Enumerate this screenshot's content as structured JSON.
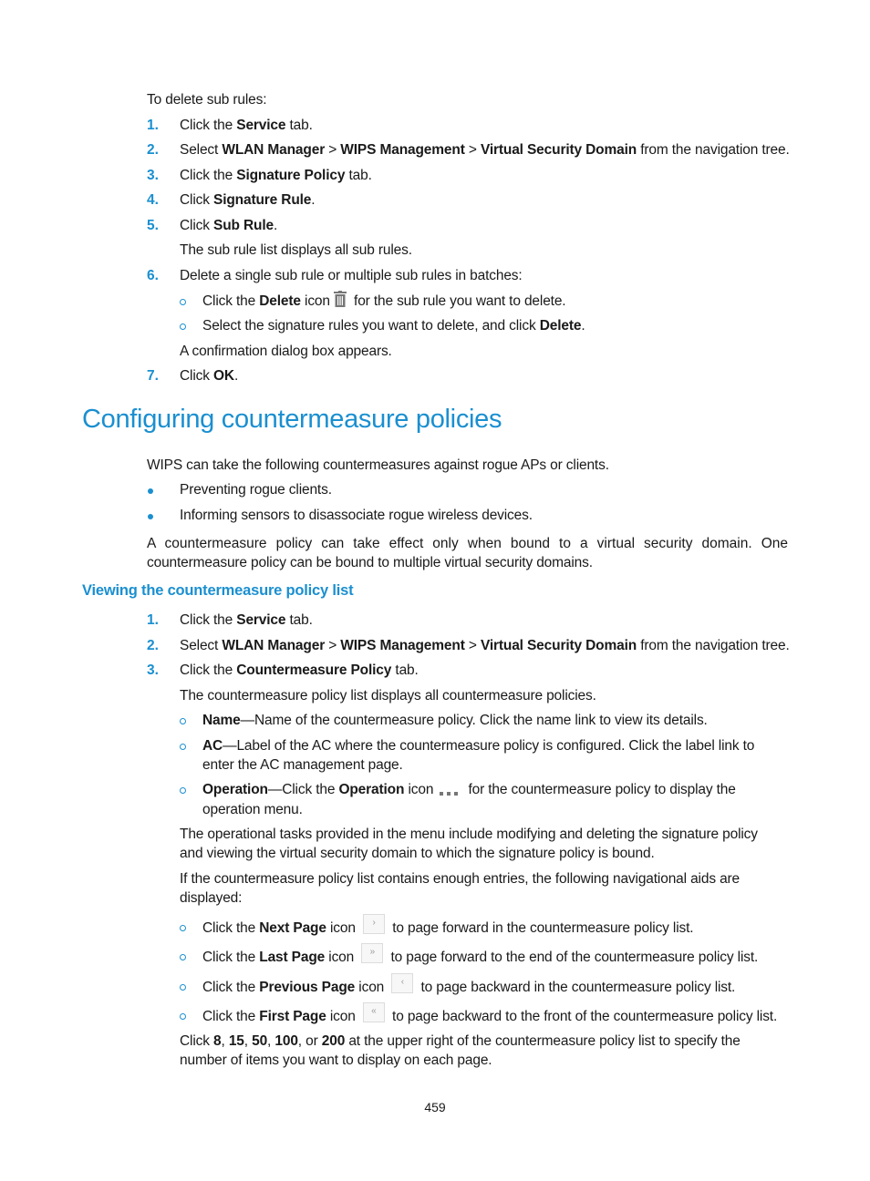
{
  "section_delete": {
    "intro": "To delete sub rules:",
    "steps": [
      {
        "num": "1.",
        "pre": "Click the ",
        "b1": "Service",
        "post": " tab."
      },
      {
        "num": "2.",
        "pre": "Select ",
        "b1": "WLAN Manager",
        "sep1": " > ",
        "b2": "WIPS Management",
        "sep2": " > ",
        "b3": "Virtual Security Domain",
        "post": " from the navigation tree."
      },
      {
        "num": "3.",
        "pre": "Click the ",
        "b1": "Signature Policy",
        "post": " tab."
      },
      {
        "num": "4.",
        "pre": "Click ",
        "b1": "Signature Rule",
        "post": "."
      },
      {
        "num": "5.",
        "pre": "Click ",
        "b1": "Sub Rule",
        "post": "."
      },
      {
        "num": "6.",
        "text": "Delete a single sub rule or multiple sub rules in batches:"
      },
      {
        "num": "7.",
        "pre": "Click ",
        "b1": "OK",
        "post": "."
      }
    ],
    "step5_note": "The sub rule list displays all sub rules.",
    "sub_bullets": [
      {
        "pre": "Click the ",
        "b1": "Delete",
        "mid": " icon",
        "icon": "trash-icon",
        "post": " for the sub rule you want to delete."
      },
      {
        "pre": "Select the signature rules you want to delete, and click ",
        "b1": "Delete",
        "post": "."
      }
    ],
    "step6_note": "A confirmation dialog box appears."
  },
  "heading_main": "Configuring countermeasure policies",
  "intro_para": "WIPS can take the following countermeasures against rogue APs or clients.",
  "bullets": [
    "Preventing rogue clients.",
    "Informing sensors to disassociate rogue wireless devices."
  ],
  "binding_para": {
    "line1": "A countermeasure policy can take effect only when bound to a virtual security domain. One",
    "line2": "countermeasure policy can be bound to multiple virtual security domains."
  },
  "heading_sub": "Viewing the countermeasure policy list",
  "section_view": {
    "steps": [
      {
        "num": "1.",
        "pre": "Click the ",
        "b1": "Service",
        "post": " tab."
      },
      {
        "num": "2.",
        "pre": "Select ",
        "b1": "WLAN Manager",
        "sep1": " > ",
        "b2": "WIPS Management",
        "sep2": " > ",
        "b3": "Virtual Security Domain",
        "post": " from the navigation tree."
      },
      {
        "num": "3.",
        "pre": "Click the ",
        "b1": "Countermeasure Policy",
        "post": " tab."
      }
    ],
    "list_note": "The countermeasure policy list displays all countermeasure policies.",
    "fields": [
      {
        "b1": "Name",
        "line1": "—Name of the countermeasure policy. Click the name link to view its details."
      },
      {
        "b1": "AC",
        "line1": "—Label of the AC where the countermeasure policy is configured. Click the label link to",
        "line2": "enter the AC management page."
      },
      {
        "b1": "Operation",
        "pre": "—Click the ",
        "b2": "Operation",
        "mid": " icon",
        "icon": "more-dots-icon",
        "post": " for the countermeasure policy to display the",
        "line2": "operation menu."
      }
    ],
    "ops_para": {
      "line1": "The operational tasks provided in the menu include modifying and deleting the signature policy",
      "line2": "and viewing the virtual security domain to which the signature policy is bound."
    },
    "nav_para": {
      "line1": "If the countermeasure policy list contains enough entries, the following navigational aids are",
      "line2": "displayed:"
    },
    "nav_items": [
      {
        "pre": "Click the ",
        "b1": "Next Page",
        "mid": " icon",
        "glyph": "›",
        "icon": "next-page-icon",
        "post": "to page forward in the countermeasure policy list."
      },
      {
        "pre": "Click the ",
        "b1": "Last Page",
        "mid": " icon",
        "glyph": "»",
        "icon": "last-page-icon",
        "post": "to page forward to the end of the countermeasure policy list."
      },
      {
        "pre": "Click the ",
        "b1": "Previous Page",
        "mid": " icon",
        "glyph": "‹",
        "icon": "previous-page-icon",
        "post": "to page backward in the countermeasure policy list."
      },
      {
        "pre": "Click the ",
        "b1": "First Page",
        "mid": " icon",
        "glyph": "«",
        "icon": "first-page-icon",
        "post": "to page backward to the front of the countermeasure policy list."
      }
    ],
    "page_size_para": {
      "pre": "Click ",
      "sizes": [
        "8",
        "15",
        "50",
        "100",
        "200"
      ],
      "sep": ", ",
      "or": ", or ",
      "post": " at the upper right of the countermeasure policy list to specify the",
      "line2": "number of items you want to display on each page."
    }
  },
  "page_number": "459",
  "colors": {
    "accent": "#1a8fd0",
    "text": "#1a1a1a"
  }
}
